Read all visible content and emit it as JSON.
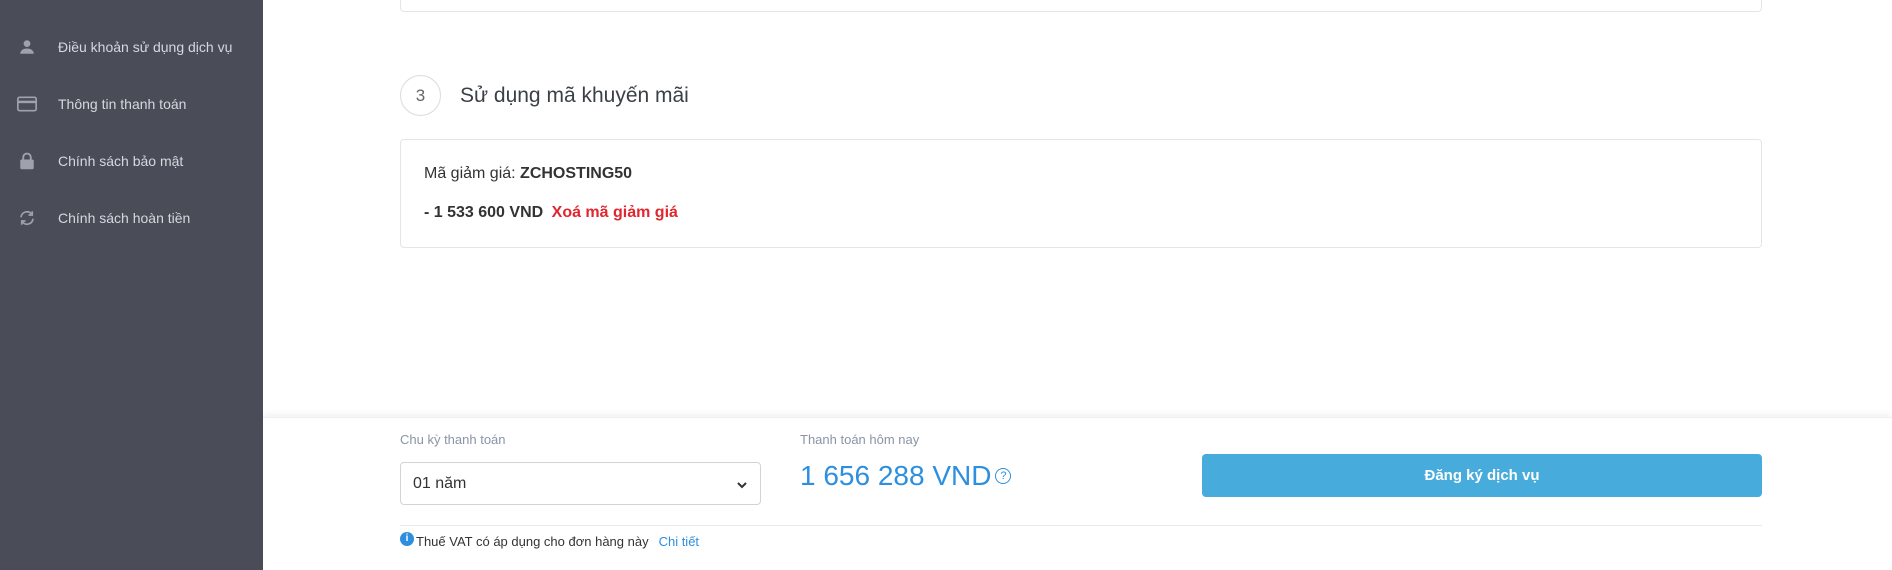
{
  "sidebar": {
    "items": [
      {
        "label": "Điều khoản sử dụng dịch vụ",
        "icon": "user-icon"
      },
      {
        "label": "Thông tin thanh toán",
        "icon": "credit-card-icon"
      },
      {
        "label": "Chính sách bảo mật",
        "icon": "lock-icon"
      },
      {
        "label": "Chính sách hoàn tiền",
        "icon": "refresh-icon"
      }
    ]
  },
  "promo_section": {
    "step_number": "3",
    "title": "Sử dụng mã khuyến mãi",
    "code_label": "Mã giảm giá:",
    "code_value": "ZCHOSTING50",
    "discount_amount": "- 1 533 600 VND",
    "remove_label": "Xoá mã giảm giá"
  },
  "footer": {
    "cycle_label": "Chu kỳ thanh toán",
    "cycle_value": "01 năm",
    "pay_today_label": "Thanh toán hôm nay",
    "pay_today_amount": "1 656 288 VND",
    "help_glyph": "?",
    "register_label": "Đăng ký dịch vụ",
    "vat_icon_glyph": "i",
    "vat_note": "Thuế VAT có áp dụng cho đơn hàng này",
    "vat_link": "Chi tiết"
  },
  "colors": {
    "sidebar_bg": "#4a4d58",
    "accent_blue": "#2e8fde",
    "button_blue": "#47acdc",
    "danger_red": "#e0262e"
  }
}
